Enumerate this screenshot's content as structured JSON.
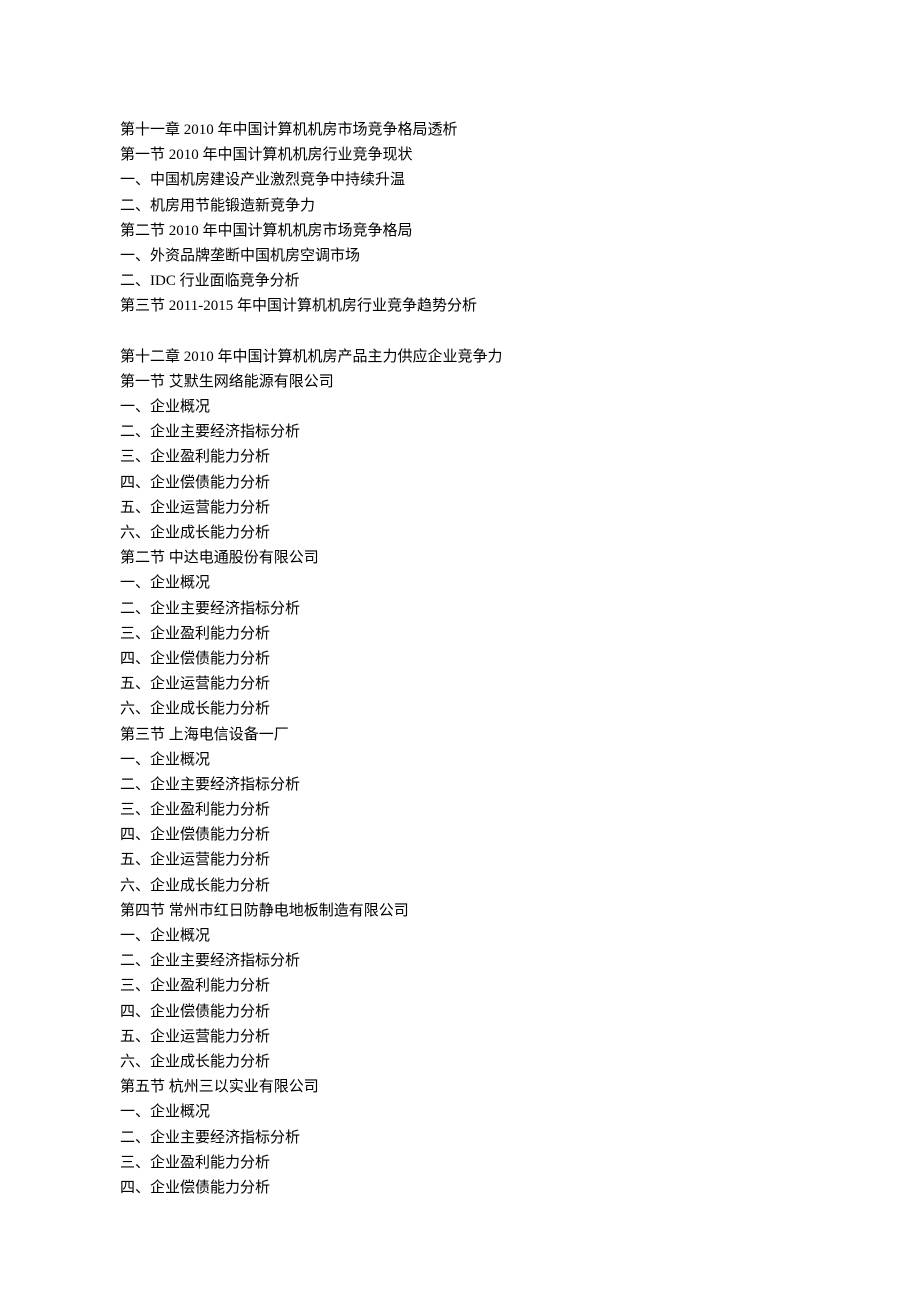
{
  "lines": [
    "第十一章  2010 年中国计算机机房市场竞争格局透析",
    "第一节 2010 年中国计算机机房行业竞争现状",
    "一、中国机房建设产业激烈竞争中持续升温",
    "二、机房用节能锻造新竞争力",
    "第二节 2010 年中国计算机机房市场竞争格局",
    "一、外资品牌垄断中国机房空调市场",
    "二、IDC 行业面临竞争分析",
    "第三节  2011-2015 年中国计算机机房行业竞争趋势分析",
    "",
    "第十二章  2010 年中国计算机机房产品主力供应企业竞争力",
    "第一节  艾默生网络能源有限公司",
    "一、企业概况",
    "二、企业主要经济指标分析",
    "三、企业盈利能力分析",
    "四、企业偿债能力分析",
    "五、企业运营能力分析",
    "六、企业成长能力分析",
    "第二节  中达电通股份有限公司",
    "一、企业概况",
    "二、企业主要经济指标分析",
    "三、企业盈利能力分析",
    "四、企业偿债能力分析",
    "五、企业运营能力分析",
    "六、企业成长能力分析",
    "第三节  上海电信设备一厂",
    "一、企业概况",
    "二、企业主要经济指标分析",
    "三、企业盈利能力分析",
    "四、企业偿债能力分析",
    "五、企业运营能力分析",
    "六、企业成长能力分析",
    "第四节  常州市红日防静电地板制造有限公司",
    "一、企业概况",
    "二、企业主要经济指标分析",
    "三、企业盈利能力分析",
    "四、企业偿债能力分析",
    "五、企业运营能力分析",
    "六、企业成长能力分析",
    "第五节  杭州三以实业有限公司",
    "一、企业概况",
    "二、企业主要经济指标分析",
    "三、企业盈利能力分析",
    "四、企业偿债能力分析"
  ]
}
